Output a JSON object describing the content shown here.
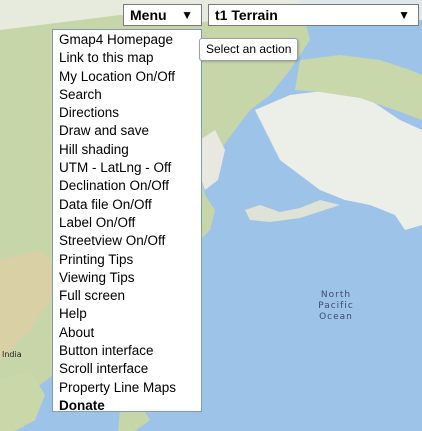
{
  "colors": {
    "ocean": "#9ec3e8",
    "land_green": "#c7d6a8",
    "land_sand": "#e3dcc0",
    "ice": "#f4f4f4"
  },
  "toolbar": {
    "menu_label": "Menu",
    "menu_arrow": "▼",
    "map_type_label": "t1 Terrain",
    "map_type_arrow": "▼"
  },
  "tooltip": {
    "text": "Select an action"
  },
  "menu": {
    "items": [
      {
        "label": "Gmap4 Homepage",
        "bold": false
      },
      {
        "label": "Link to this map",
        "bold": false
      },
      {
        "label": "My Location On/Off",
        "bold": false
      },
      {
        "label": "Search",
        "bold": false
      },
      {
        "label": "Directions",
        "bold": false
      },
      {
        "label": "Draw and save",
        "bold": false
      },
      {
        "label": "Hill shading",
        "bold": false
      },
      {
        "label": "UTM - LatLng - Off",
        "bold": false
      },
      {
        "label": "Declination On/Off",
        "bold": false
      },
      {
        "label": "Data file On/Off",
        "bold": false
      },
      {
        "label": "Label On/Off",
        "bold": false
      },
      {
        "label": "Streetview On/Off",
        "bold": false
      },
      {
        "label": "Printing Tips",
        "bold": false
      },
      {
        "label": "Viewing Tips",
        "bold": false
      },
      {
        "label": "Full screen",
        "bold": false
      },
      {
        "label": "Help",
        "bold": false
      },
      {
        "label": "About",
        "bold": false
      },
      {
        "label": "Button interface",
        "bold": false
      },
      {
        "label": "Scroll interface",
        "bold": false
      },
      {
        "label": "Property Line Maps",
        "bold": false
      },
      {
        "label": "Donate",
        "bold": true
      }
    ]
  },
  "map": {
    "ocean_label": "North\nPacific\nOcean",
    "country_label": "India"
  }
}
